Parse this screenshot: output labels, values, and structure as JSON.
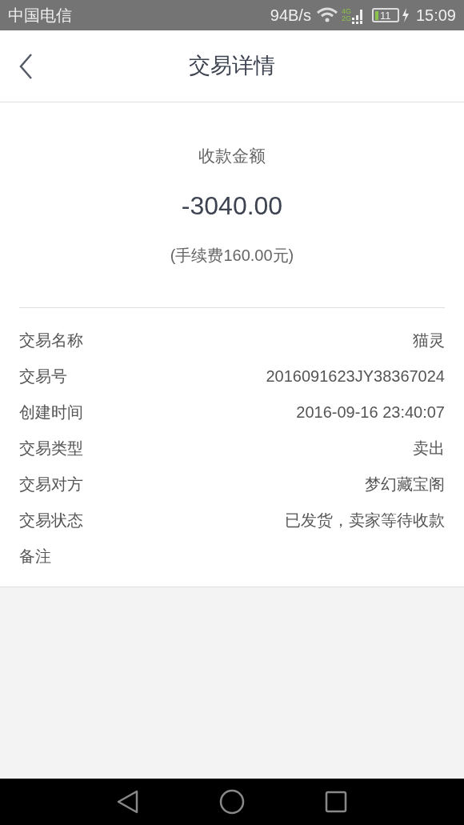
{
  "status_bar": {
    "carrier": "中国电信",
    "speed": "94B/s",
    "network_4g": "4G",
    "network_2g": "2G",
    "battery": "11",
    "time": "15:09"
  },
  "header": {
    "title": "交易详情"
  },
  "summary": {
    "label": "收款金额",
    "amount": "-3040.00",
    "fee": "(手续费160.00元)"
  },
  "details": [
    {
      "label": "交易名称",
      "value": "猫灵"
    },
    {
      "label": "交易号",
      "value": "2016091623JY38367024"
    },
    {
      "label": "创建时间",
      "value": "2016-09-16 23:40:07"
    },
    {
      "label": "交易类型",
      "value": "卖出"
    },
    {
      "label": "交易对方",
      "value": "梦幻藏宝阁"
    },
    {
      "label": "交易状态",
      "value": "已发货，卖家等待收款"
    },
    {
      "label": "备注"
    }
  ]
}
